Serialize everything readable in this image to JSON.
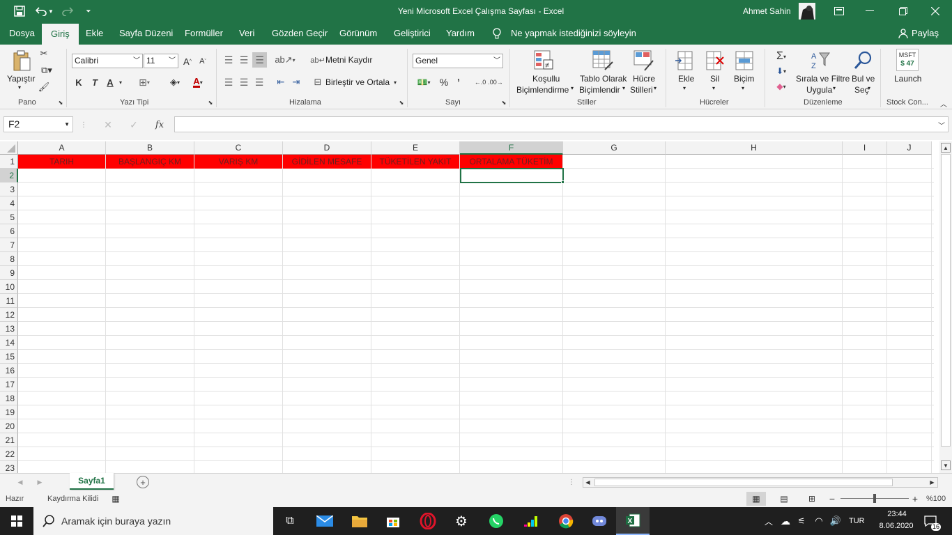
{
  "title_bar": {
    "doc_title": "Yeni Microsoft Excel Çalışma Sayfası  -  Excel",
    "user_name": "Ahmet Sahin"
  },
  "ribbon_tabs": [
    "Dosya",
    "Giriş",
    "Ekle",
    "Sayfa Düzeni",
    "Formüller",
    "Veri",
    "Gözden Geçir",
    "Görünüm",
    "Geliştirici",
    "Yardım"
  ],
  "tell_me": "Ne yapmak istediğinizi söyleyin",
  "share": "Paylaş",
  "ribbon": {
    "paste": "Yapıştır",
    "font_name": "Calibri",
    "font_size": "11",
    "bold": "K",
    "italic": "T",
    "underline": "A",
    "wrap_text": "Metni Kaydır",
    "merge_center": "Birleştir ve Ortala",
    "number_format": "Genel",
    "conditional_fmt_1": "Koşullu",
    "conditional_fmt_2": "Biçimlendirme",
    "table_fmt_1": "Tablo Olarak",
    "table_fmt_2": "Biçimlendir",
    "cell_styles_1": "Hücre",
    "cell_styles_2": "Stilleri",
    "insert": "Ekle",
    "delete": "Sil",
    "format": "Biçim",
    "sort_filter_1": "Sırala ve Filtre",
    "sort_filter_2": "Uygula",
    "find_select_1": "Bul ve",
    "find_select_2": "Seç",
    "stock_ticker": "MSFT",
    "stock_price": "$ 47",
    "launch": "Launch",
    "groups": {
      "clipboard": "Pano",
      "font": "Yazı Tipi",
      "alignment": "Hizalama",
      "number": "Sayı",
      "styles": "Stiller",
      "cells": "Hücreler",
      "editing": "Düzenleme",
      "stock": "Stock Con..."
    }
  },
  "formula_bar": {
    "name_box": "F2",
    "fx": "fx",
    "formula": ""
  },
  "columns": [
    "A",
    "B",
    "C",
    "D",
    "E",
    "F",
    "G",
    "H",
    "I",
    "J"
  ],
  "rows": [
    "1",
    "2",
    "3",
    "4",
    "5",
    "6",
    "7",
    "8",
    "9",
    "10",
    "11",
    "12",
    "13",
    "14",
    "15",
    "16",
    "17",
    "18",
    "19",
    "20",
    "21",
    "22",
    "23"
  ],
  "header_cells": [
    "TARIH",
    "BAŞLANGIÇ KM",
    "VARIŞ KM",
    "GİDİLEN MESAFE",
    "TÜKETİLEN YAKIT",
    "ORTALAMA TÜKETİM"
  ],
  "active_cell": "F2",
  "sheet_tabs": [
    "Sayfa1"
  ],
  "status": {
    "ready": "Hazır",
    "scroll_lock": "Kaydırma Kilidi",
    "zoom": "%100"
  },
  "taskbar": {
    "search_placeholder": "Aramak için buraya yazın",
    "lang": "TUR",
    "time": "23:44",
    "date": "8.06.2020",
    "notif_count": "16"
  },
  "colors": {
    "excel_green": "#217346",
    "header_red": "#ff0000",
    "header_text": "#6b1f1f"
  }
}
